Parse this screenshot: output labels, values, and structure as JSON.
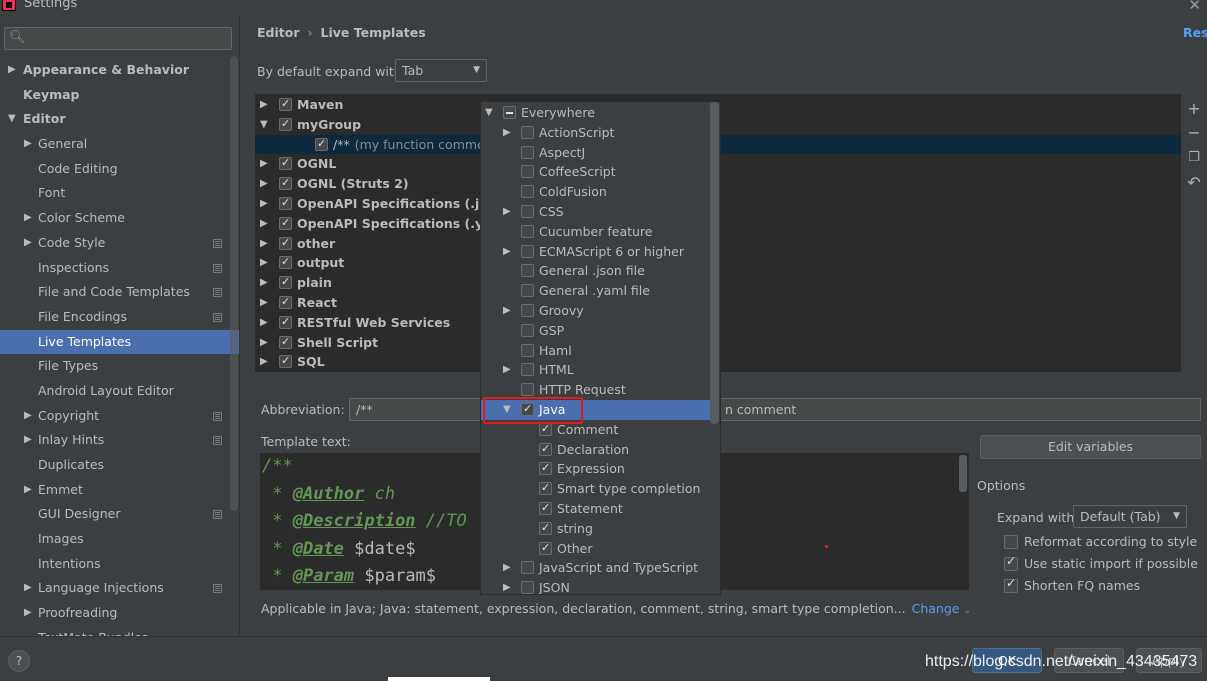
{
  "window": {
    "title": "Settings"
  },
  "sidebar": {
    "search_placeholder": "",
    "items": [
      {
        "label": "Appearance & Behavior",
        "indent": 0,
        "arrow": "▶",
        "bold": true,
        "copy": false,
        "selected": false
      },
      {
        "label": "Keymap",
        "indent": 0,
        "arrow": "",
        "bold": true,
        "copy": false,
        "selected": false
      },
      {
        "label": "Editor",
        "indent": 0,
        "arrow": "▼",
        "bold": true,
        "copy": false,
        "selected": false
      },
      {
        "label": "General",
        "indent": 1,
        "arrow": "▶",
        "bold": false,
        "copy": false,
        "selected": false
      },
      {
        "label": "Code Editing",
        "indent": 1,
        "arrow": "",
        "bold": false,
        "copy": false,
        "selected": false
      },
      {
        "label": "Font",
        "indent": 1,
        "arrow": "",
        "bold": false,
        "copy": false,
        "selected": false
      },
      {
        "label": "Color Scheme",
        "indent": 1,
        "arrow": "▶",
        "bold": false,
        "copy": false,
        "selected": false
      },
      {
        "label": "Code Style",
        "indent": 1,
        "arrow": "▶",
        "bold": false,
        "copy": true,
        "selected": false
      },
      {
        "label": "Inspections",
        "indent": 1,
        "arrow": "",
        "bold": false,
        "copy": true,
        "selected": false
      },
      {
        "label": "File and Code Templates",
        "indent": 1,
        "arrow": "",
        "bold": false,
        "copy": true,
        "selected": false
      },
      {
        "label": "File Encodings",
        "indent": 1,
        "arrow": "",
        "bold": false,
        "copy": true,
        "selected": false
      },
      {
        "label": "Live Templates",
        "indent": 1,
        "arrow": "",
        "bold": false,
        "copy": false,
        "selected": true
      },
      {
        "label": "File Types",
        "indent": 1,
        "arrow": "",
        "bold": false,
        "copy": false,
        "selected": false
      },
      {
        "label": "Android Layout Editor",
        "indent": 1,
        "arrow": "",
        "bold": false,
        "copy": false,
        "selected": false
      },
      {
        "label": "Copyright",
        "indent": 1,
        "arrow": "▶",
        "bold": false,
        "copy": true,
        "selected": false
      },
      {
        "label": "Inlay Hints",
        "indent": 1,
        "arrow": "▶",
        "bold": false,
        "copy": true,
        "selected": false
      },
      {
        "label": "Duplicates",
        "indent": 1,
        "arrow": "",
        "bold": false,
        "copy": false,
        "selected": false
      },
      {
        "label": "Emmet",
        "indent": 1,
        "arrow": "▶",
        "bold": false,
        "copy": false,
        "selected": false
      },
      {
        "label": "GUI Designer",
        "indent": 1,
        "arrow": "",
        "bold": false,
        "copy": true,
        "selected": false
      },
      {
        "label": "Images",
        "indent": 1,
        "arrow": "",
        "bold": false,
        "copy": false,
        "selected": false
      },
      {
        "label": "Intentions",
        "indent": 1,
        "arrow": "",
        "bold": false,
        "copy": false,
        "selected": false
      },
      {
        "label": "Language Injections",
        "indent": 1,
        "arrow": "▶",
        "bold": false,
        "copy": true,
        "selected": false
      },
      {
        "label": "Proofreading",
        "indent": 1,
        "arrow": "▶",
        "bold": false,
        "copy": false,
        "selected": false
      },
      {
        "label": "TextMate Bundles",
        "indent": 1,
        "arrow": "",
        "bold": false,
        "copy": false,
        "selected": false
      }
    ]
  },
  "header": {
    "breadcrumb_parent": "Editor",
    "breadcrumb_sep": "›",
    "breadcrumb_current": "Live Templates",
    "reset_label": "Reset"
  },
  "expand": {
    "label": "By default expand with",
    "value": "Tab"
  },
  "tree": [
    {
      "label": "Maven",
      "arrow": "▶",
      "checked": true,
      "level": 0,
      "selected": false,
      "hint": ""
    },
    {
      "label": "myGroup",
      "arrow": "▼",
      "checked": true,
      "level": 0,
      "selected": false,
      "hint": ""
    },
    {
      "label": "/**",
      "arrow": "",
      "checked": true,
      "level": 1,
      "selected": true,
      "hint": "(my function comment)"
    },
    {
      "label": "OGNL",
      "arrow": "▶",
      "checked": true,
      "level": 0,
      "selected": false,
      "hint": ""
    },
    {
      "label": "OGNL (Struts 2)",
      "arrow": "▶",
      "checked": true,
      "level": 0,
      "selected": false,
      "hint": ""
    },
    {
      "label": "OpenAPI Specifications (.json)",
      "arrow": "▶",
      "checked": true,
      "level": 0,
      "selected": false,
      "hint": ""
    },
    {
      "label": "OpenAPI Specifications (.yaml)",
      "arrow": "▶",
      "checked": true,
      "level": 0,
      "selected": false,
      "hint": ""
    },
    {
      "label": "other",
      "arrow": "▶",
      "checked": true,
      "level": 0,
      "selected": false,
      "hint": ""
    },
    {
      "label": "output",
      "arrow": "▶",
      "checked": true,
      "level": 0,
      "selected": false,
      "hint": ""
    },
    {
      "label": "plain",
      "arrow": "▶",
      "checked": true,
      "level": 0,
      "selected": false,
      "hint": ""
    },
    {
      "label": "React",
      "arrow": "▶",
      "checked": true,
      "level": 0,
      "selected": false,
      "hint": ""
    },
    {
      "label": "RESTful Web Services",
      "arrow": "▶",
      "checked": true,
      "level": 0,
      "selected": false,
      "hint": ""
    },
    {
      "label": "Shell Script",
      "arrow": "▶",
      "checked": true,
      "level": 0,
      "selected": false,
      "hint": ""
    },
    {
      "label": "SQL",
      "arrow": "▶",
      "checked": true,
      "level": 0,
      "selected": false,
      "hint": ""
    }
  ],
  "toolbar_icons": [
    "add-icon",
    "remove-icon",
    "copy-icon",
    "restore-icon"
  ],
  "abbreviation": {
    "label": "Abbreviation:",
    "value": "/**",
    "description_visible": "n comment"
  },
  "template": {
    "label": "Template text:",
    "lines": [
      {
        "prefix": "/**",
        "tag": "",
        "rest": ""
      },
      {
        "prefix": " * ",
        "tag": "@Author",
        "rest": " ch"
      },
      {
        "prefix": " * ",
        "tag": "@Description",
        "rest": " //TO"
      },
      {
        "prefix": " * ",
        "tag": "@Date",
        "rest": " $date$"
      },
      {
        "prefix": " * ",
        "tag": "@Param",
        "rest": " $param$"
      }
    ]
  },
  "applicable": {
    "text": "Applicable in Java; Java: statement, expression, declaration, comment, string, smart type completion...",
    "change_label": "Change"
  },
  "options": {
    "edit_variables_label": "Edit variables",
    "title": "Options",
    "expand_with_label": "Expand with",
    "expand_with_value": "Default (Tab)",
    "checkboxes": [
      {
        "label": "Reformat according to style",
        "checked": false
      },
      {
        "label": "Use static import if possible",
        "checked": true
      },
      {
        "label": "Shorten FQ names",
        "checked": true
      }
    ]
  },
  "context_popup": {
    "items": [
      {
        "label": "Everywhere",
        "arrow": "▼",
        "state": "partial",
        "level": 0,
        "selected": false
      },
      {
        "label": "ActionScript",
        "arrow": "▶",
        "state": "none",
        "level": 1,
        "selected": false
      },
      {
        "label": "AspectJ",
        "arrow": "",
        "state": "none",
        "level": 1,
        "selected": false
      },
      {
        "label": "CoffeeScript",
        "arrow": "",
        "state": "none",
        "level": 1,
        "selected": false
      },
      {
        "label": "ColdFusion",
        "arrow": "",
        "state": "none",
        "level": 1,
        "selected": false
      },
      {
        "label": "CSS",
        "arrow": "▶",
        "state": "none",
        "level": 1,
        "selected": false
      },
      {
        "label": "Cucumber feature",
        "arrow": "",
        "state": "none",
        "level": 1,
        "selected": false
      },
      {
        "label": "ECMAScript 6 or higher",
        "arrow": "▶",
        "state": "none",
        "level": 1,
        "selected": false
      },
      {
        "label": "General .json file",
        "arrow": "",
        "state": "none",
        "level": 1,
        "selected": false
      },
      {
        "label": "General .yaml file",
        "arrow": "",
        "state": "none",
        "level": 1,
        "selected": false
      },
      {
        "label": "Groovy",
        "arrow": "▶",
        "state": "none",
        "level": 1,
        "selected": false
      },
      {
        "label": "GSP",
        "arrow": "",
        "state": "none",
        "level": 1,
        "selected": false
      },
      {
        "label": "Haml",
        "arrow": "",
        "state": "none",
        "level": 1,
        "selected": false
      },
      {
        "label": "HTML",
        "arrow": "▶",
        "state": "none",
        "level": 1,
        "selected": false
      },
      {
        "label": "HTTP Request",
        "arrow": "",
        "state": "none",
        "level": 1,
        "selected": false
      },
      {
        "label": "Java",
        "arrow": "▼",
        "state": "checked",
        "level": 1,
        "selected": true
      },
      {
        "label": "Comment",
        "arrow": "",
        "state": "checked",
        "level": 2,
        "selected": false
      },
      {
        "label": "Declaration",
        "arrow": "",
        "state": "checked",
        "level": 2,
        "selected": false
      },
      {
        "label": "Expression",
        "arrow": "",
        "state": "checked",
        "level": 2,
        "selected": false
      },
      {
        "label": "Smart type completion",
        "arrow": "",
        "state": "checked",
        "level": 2,
        "selected": false
      },
      {
        "label": "Statement",
        "arrow": "",
        "state": "checked",
        "level": 2,
        "selected": false
      },
      {
        "label": "string",
        "arrow": "",
        "state": "checked",
        "level": 2,
        "selected": false
      },
      {
        "label": "Other",
        "arrow": "",
        "state": "checked",
        "level": 2,
        "selected": false
      },
      {
        "label": "JavaScript and TypeScript",
        "arrow": "▶",
        "state": "none",
        "level": 1,
        "selected": false
      },
      {
        "label": "JSON",
        "arrow": "▶",
        "state": "none",
        "level": 1,
        "selected": false
      }
    ]
  },
  "footer": {
    "help_label": "?",
    "ok_label": "OK",
    "cancel_label": "Cancel",
    "apply_label": "Apply",
    "watermark": "https://blog.csdn.net/weixin_43435473"
  },
  "colors": {
    "accent": "#4b6eaf",
    "link": "#589df6",
    "highlight_border": "#e51a1a"
  }
}
